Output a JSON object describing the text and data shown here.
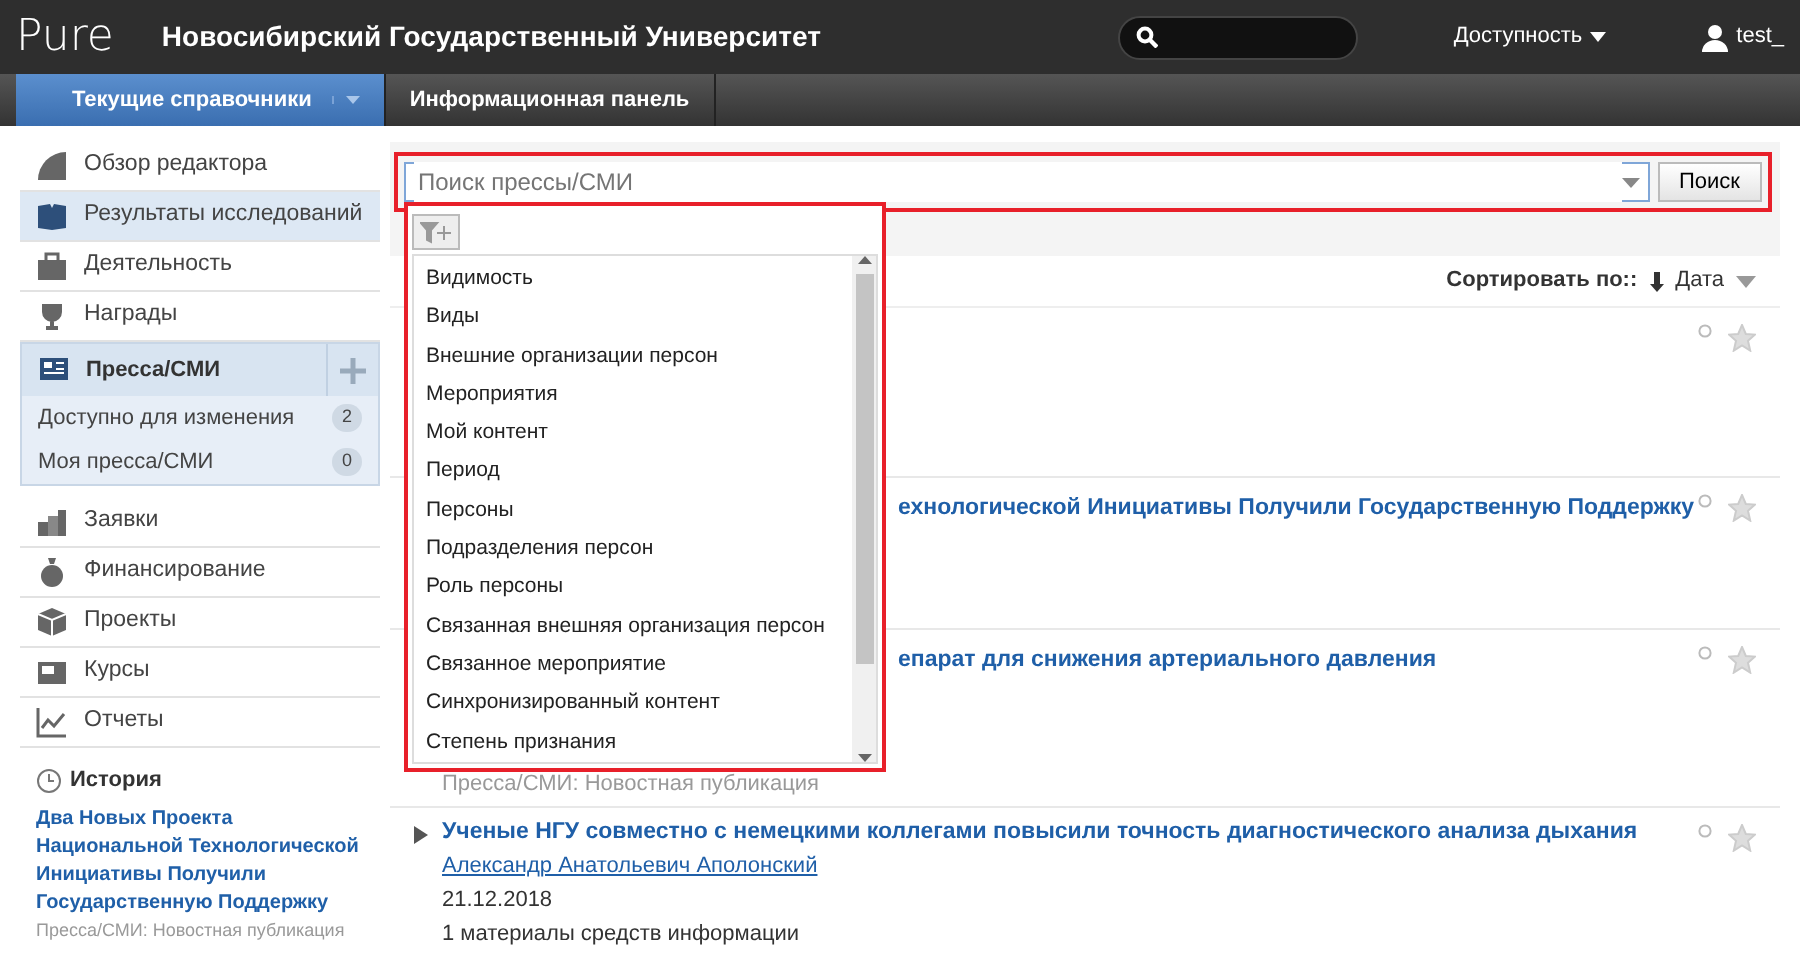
{
  "header": {
    "logo": "Pure",
    "title": "Новосибирский Государственный Университет",
    "accessibility": "Доступность",
    "user": "test_"
  },
  "subnav": [
    {
      "label": "Текущие справочники",
      "selected": true
    },
    {
      "label": "Информационная панель",
      "selected": false
    }
  ],
  "sidebar": {
    "items": [
      {
        "kind": "link",
        "label": "Обзор редактора",
        "selected": false
      },
      {
        "kind": "link",
        "label": "Результаты исследований",
        "selected": true
      },
      {
        "kind": "link",
        "label": "Деятельность",
        "selected": false
      },
      {
        "kind": "link",
        "label": "Награды",
        "selected": false
      },
      {
        "kind": "group",
        "label": "Пресса/СМИ",
        "selected": false,
        "children": [
          {
            "label": "Доступно для изменения",
            "count": "2"
          },
          {
            "label": "Моя пресса/СМИ",
            "count": "0"
          }
        ]
      },
      {
        "kind": "link",
        "label": "Заявки",
        "selected": false
      },
      {
        "kind": "link",
        "label": "Финансирование",
        "selected": false
      },
      {
        "kind": "link",
        "label": "Проекты",
        "selected": false
      },
      {
        "kind": "link",
        "label": "Курсы",
        "selected": false
      },
      {
        "kind": "link",
        "label": "Отчеты",
        "selected": false
      }
    ],
    "history": {
      "title": "История",
      "link": "Два Новых Проекта Национальной Технологической Инициативы Получили Государственную Поддержку",
      "meta": "Пресса/СМИ: Новостная публикация"
    }
  },
  "search": {
    "placeholder": "Поиск прессы/СМИ",
    "button": "Поиск"
  },
  "filter_menu": {
    "options": [
      "Видимость",
      "Виды",
      "Внешние организации персон",
      "Мероприятия",
      "Мой контент",
      "Период",
      "Персоны",
      "Подразделения персон",
      "Роль персоны",
      "Связанная внешняя организация персон",
      "Связанное мероприятие",
      "Синхронизированный контент",
      "Степень признания"
    ]
  },
  "sort": {
    "label": "Сортировать по::",
    "value": "Дата"
  },
  "results": [
    {
      "kind": "hidden"
    },
    {
      "kind": "covered",
      "title": "ехнологической Инициативы Получили Государственную Поддержку"
    },
    {
      "kind": "covered",
      "title": "епарат для снижения артериального давления",
      "type": "Пресса/СМИ: Новостная публикация"
    },
    {
      "kind": "full",
      "title": "Ученые НГУ совместно с немецкими коллегами повысили точность диагностического анализа дыхания",
      "author": "Александр Анатольевич Аполонский",
      "date": "21.12.2018",
      "count": "1 материалы средств информации"
    }
  ]
}
